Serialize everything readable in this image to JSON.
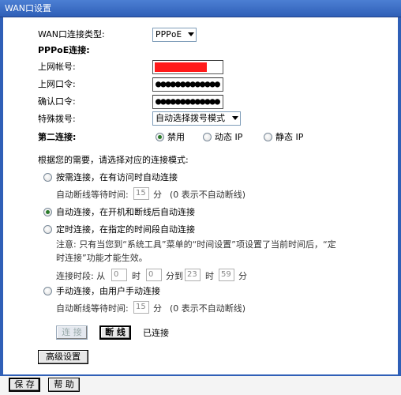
{
  "window": {
    "title": "WAN口设置"
  },
  "form": {
    "wan_type_label": "WAN口连接类型:",
    "wan_type_value": "PPPoE",
    "pppoe_section": "PPPoE连接:",
    "username_label": "上网帐号:",
    "password_label": "上网口令:",
    "confirm_label": "确认口令:",
    "password_value": "●●●●●●●●●●●●●",
    "confirm_value": "●●●●●●●●●●●●●",
    "dial_label": "特殊拨号:",
    "dial_value": "自动选择拨号模式",
    "second_conn_label": "第二连接:",
    "second_options": [
      "禁用",
      "动态 IP",
      "静态 IP"
    ],
    "second_selected": 0,
    "mode_prompt": "根据您的需要，请选择对应的连接模式:",
    "modes": [
      {
        "label": "按需连接，在有访问时自动连接",
        "selected": false
      },
      {
        "label": "自动连接，在开机和断线后自动连接",
        "selected": true
      },
      {
        "label": "定时连接，在指定的时间段自动连接",
        "selected": false
      },
      {
        "label": "手动连接，由用户手动连接",
        "selected": false
      }
    ],
    "idle1_label": "自动断线等待时间:",
    "idle1_value": "15",
    "idle_unit": "分",
    "idle_note": "(0 表示不自动断线)",
    "idle2_label": "自动断线等待时间:",
    "idle2_value": "15",
    "timed_note_line1": "注意: 只有当您到“系统工具”菜单的“时间设置”项设置了当前时间后，“定",
    "timed_note_line2": "时连接”功能才能生效。",
    "period_label": "连接时段: 从",
    "period_from_h": "0",
    "hour_unit": "时",
    "period_from_m": "0",
    "min_to": "分到",
    "period_to_h": "23",
    "period_to_m": "59",
    "min_unit": "分",
    "connect_btn": "连 接",
    "disconnect_btn": "断 线",
    "status_text": "已连接",
    "advanced_btn": "高级设置"
  },
  "footer": {
    "save_btn": "保 存",
    "help_btn": "帮 助"
  },
  "colors": {
    "frame": "#2f5fb7",
    "radio_selected": "#2a7a2a",
    "mask": "#ff1a1a"
  }
}
